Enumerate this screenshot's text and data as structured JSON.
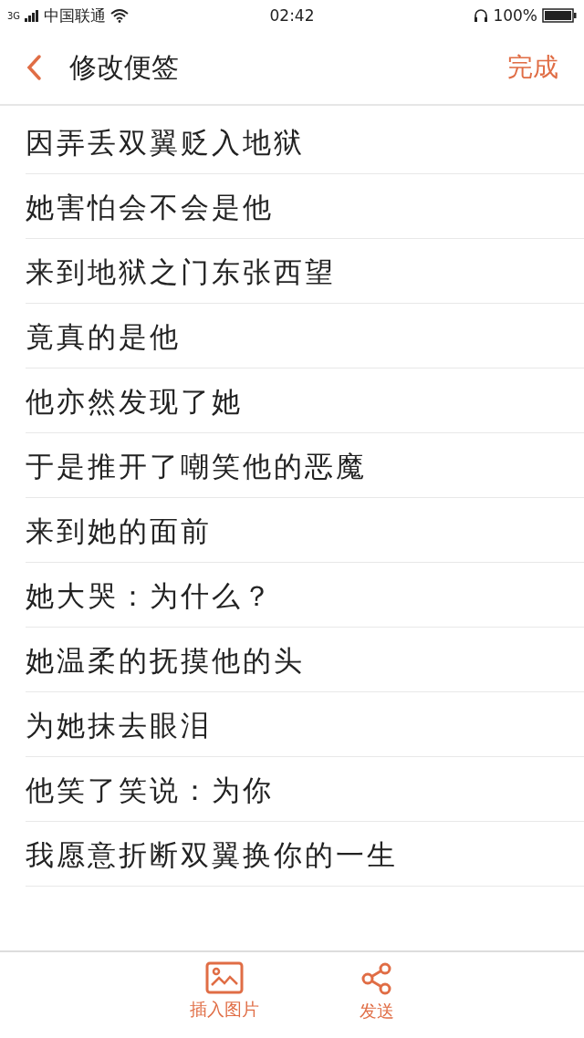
{
  "status_bar": {
    "network": "3G",
    "carrier": "中国联通",
    "time": "02:42",
    "battery": "100%"
  },
  "header": {
    "title": "修改便签",
    "action": "完成"
  },
  "note_lines": [
    "因弄丢双翼贬入地狱",
    "她害怕会不会是他",
    "来到地狱之门东张西望",
    "竟真的是他",
    "他亦然发现了她",
    "于是推开了嘲笑他的恶魔",
    "来到她的面前",
    "她大哭：为什么？",
    "她温柔的抚摸他的头",
    "为她抹去眼泪",
    "他笑了笑说：为你",
    "我愿意折断双翼换你的一生"
  ],
  "bottom_bar": [
    {
      "kind": "image",
      "label": "插入图片"
    },
    {
      "kind": "share",
      "label": "发送"
    }
  ]
}
